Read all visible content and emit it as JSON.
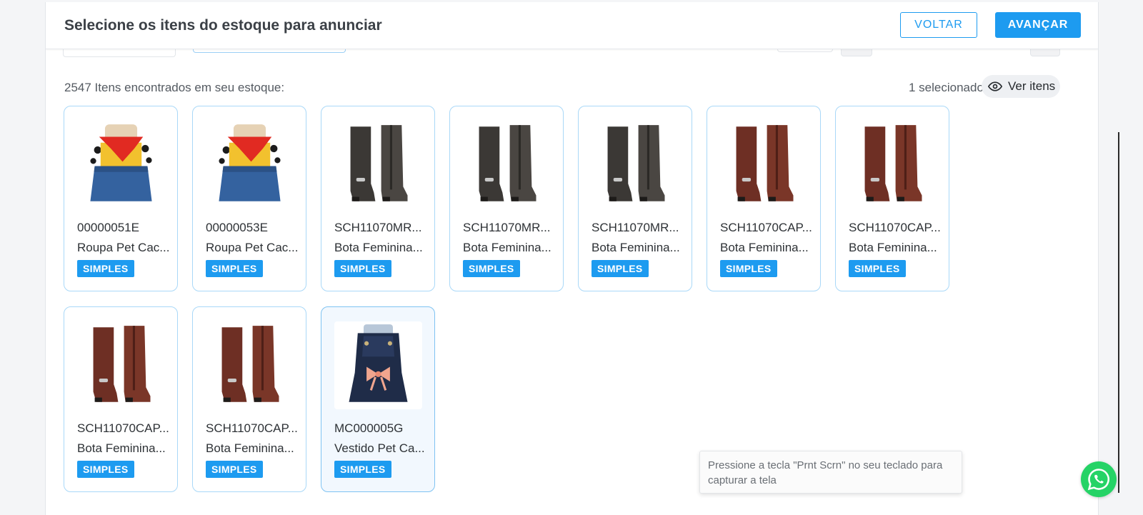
{
  "header": {
    "title": "Selecione os itens do estoque para anunciar",
    "back_label": "VOLTAR",
    "next_label": "AVANÇAR"
  },
  "summary": {
    "count_text": "2547 Itens encontrados em seu estoque:",
    "selected_text": "1 selecionados",
    "view_items_label": "Ver itens",
    "view_icon": "eye-icon"
  },
  "items": [
    {
      "sku": "00000051E",
      "name": "Roupa Pet Cac...",
      "type": "SIMPLES",
      "image": "pet-cowboy-outfit",
      "selected": false
    },
    {
      "sku": "00000053E",
      "name": "Roupa Pet Cac...",
      "type": "SIMPLES",
      "image": "pet-cowboy-outfit",
      "selected": false
    },
    {
      "sku": "SCH11070MR...",
      "name": "Bota Feminina...",
      "type": "SIMPLES",
      "image": "dark-brown-boots",
      "selected": false
    },
    {
      "sku": "SCH11070MR...",
      "name": "Bota Feminina...",
      "type": "SIMPLES",
      "image": "dark-brown-boots",
      "selected": false
    },
    {
      "sku": "SCH11070MR...",
      "name": "Bota Feminina...",
      "type": "SIMPLES",
      "image": "dark-brown-boots",
      "selected": false
    },
    {
      "sku": "SCH11070CAP...",
      "name": "Bota Feminina...",
      "type": "SIMPLES",
      "image": "brown-boots",
      "selected": false
    },
    {
      "sku": "SCH11070CAP...",
      "name": "Bota Feminina...",
      "type": "SIMPLES",
      "image": "brown-boots",
      "selected": false
    },
    {
      "sku": "SCH11070CAP...",
      "name": "Bota Feminina...",
      "type": "SIMPLES",
      "image": "brown-boots",
      "selected": false
    },
    {
      "sku": "SCH11070CAP...",
      "name": "Bota Feminina...",
      "type": "SIMPLES",
      "image": "brown-boots",
      "selected": false
    },
    {
      "sku": "MC000005G",
      "name": "Vestido Pet Ca...",
      "type": "SIMPLES",
      "image": "pet-denim-dress",
      "selected": true
    }
  ],
  "tooltip": {
    "text": "Pressione a tecla \"Prnt Scrn\" no seu teclado para capturar a tela"
  },
  "whatsapp": {
    "icon": "whatsapp-icon"
  },
  "colors": {
    "accent": "#1d9bf0",
    "card_border": "#a9d8f8",
    "selected_bg": "#f2f8fe",
    "whatsapp": "#25d366"
  }
}
